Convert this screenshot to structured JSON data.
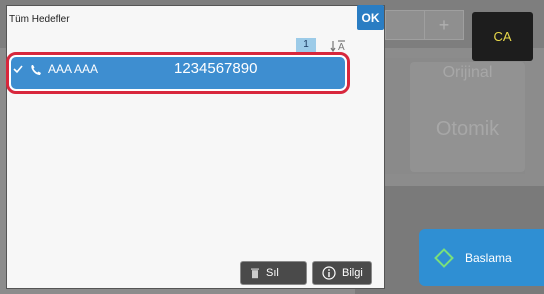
{
  "dialog": {
    "title": "Tüm Hedefler",
    "ok_label": "OK",
    "page_number": "1"
  },
  "list": {
    "items": [
      {
        "name": "AAA AAA",
        "number": "1234567890",
        "selected": true,
        "type_icon": "phone-icon"
      }
    ]
  },
  "footer": {
    "delete_label": "Sıl",
    "info_label": "Bilgi"
  },
  "background": {
    "tile_label_top": "Orijinal",
    "tile_label_main": "Otomik",
    "tab_plus": "+"
  },
  "side": {
    "ca_label": "CA",
    "start_label": "Baslama"
  },
  "colors": {
    "accent": "#3e8ed0",
    "highlight_border": "#d8273c",
    "ok_blue": "#2a7dc3",
    "ca_text": "#e8d84a"
  }
}
